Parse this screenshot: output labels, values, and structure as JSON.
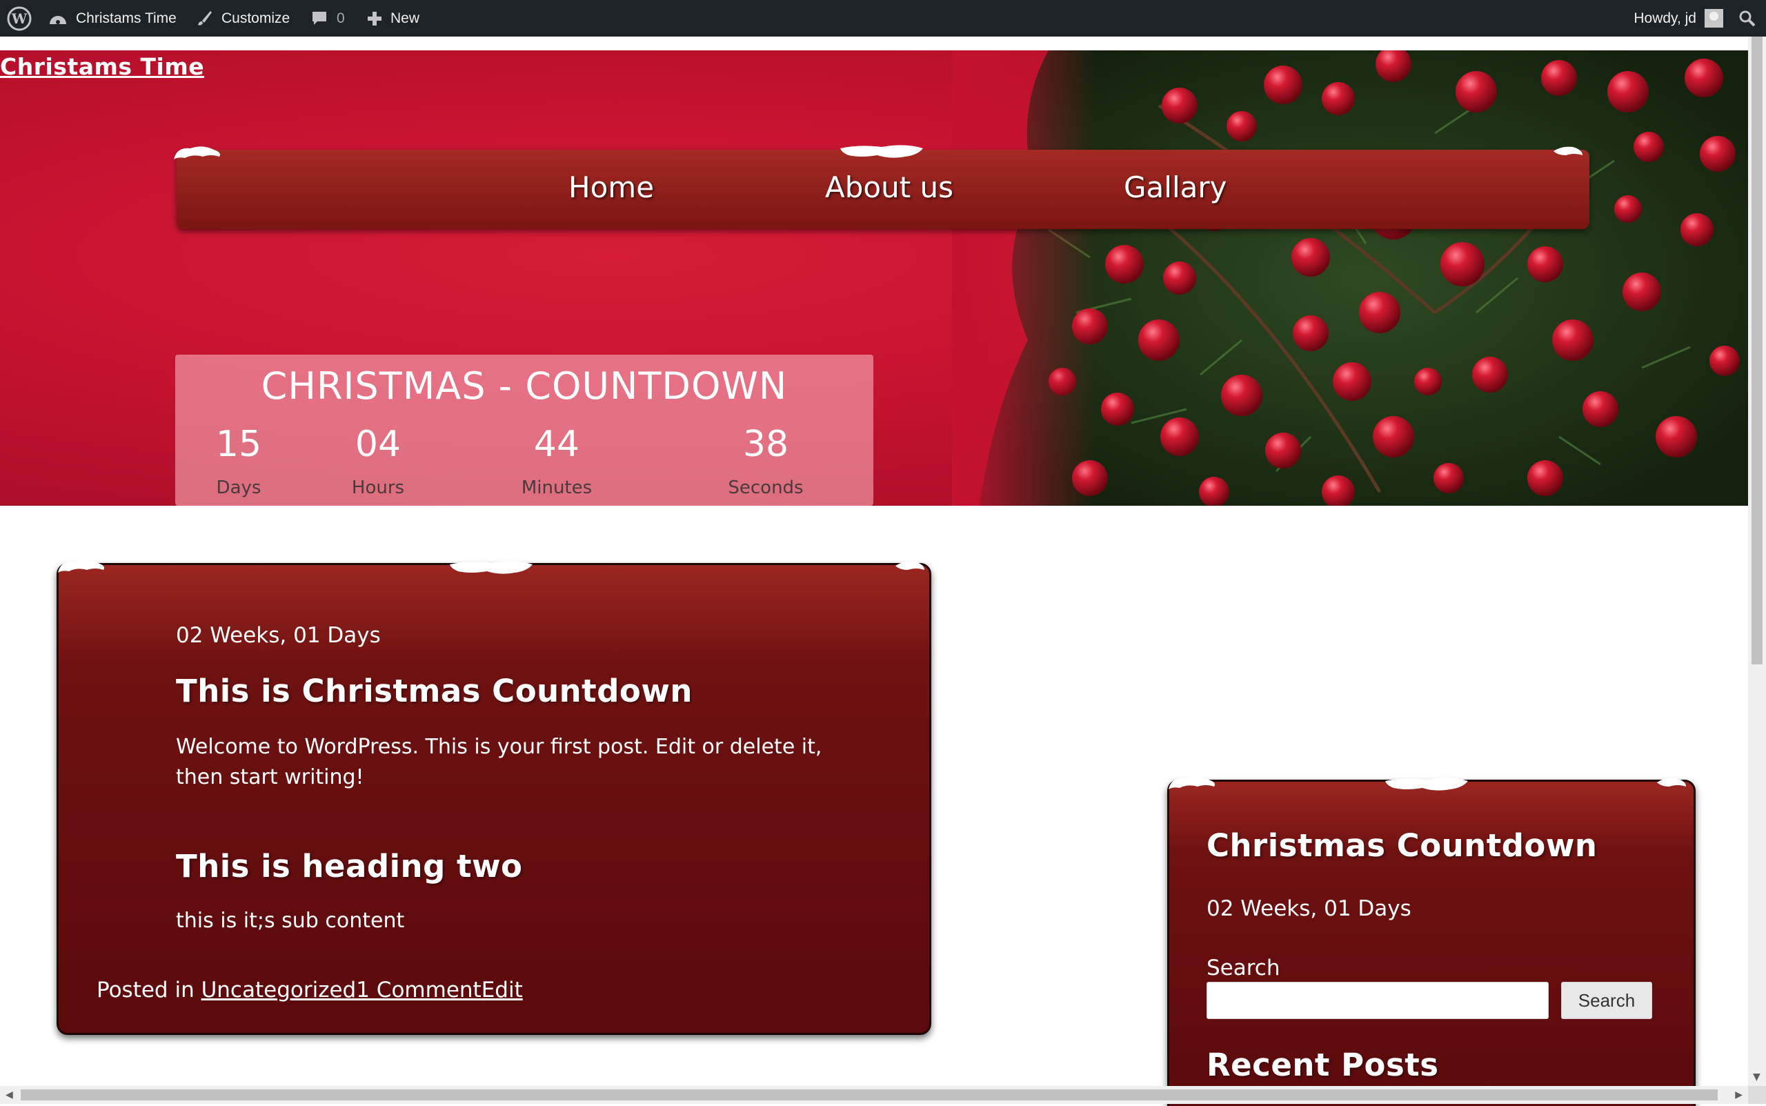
{
  "adminbar": {
    "site_name": "Christams Time",
    "customize": "Customize",
    "comments_count": "0",
    "new_label": "New",
    "howdy": "Howdy, jd"
  },
  "hero": {
    "site_title": "Christams Time",
    "nav": [
      "Home",
      "About us",
      "Gallary"
    ]
  },
  "countdown": {
    "title": "CHRISTMAS - COUNTDOWN",
    "units": [
      {
        "value": "15",
        "label": "Days"
      },
      {
        "value": "04",
        "label": "Hours"
      },
      {
        "value": "44",
        "label": "Minutes"
      },
      {
        "value": "38",
        "label": "Seconds"
      }
    ]
  },
  "post": {
    "date": "02 Weeks, 01 Days",
    "title": "This is Christmas Countdown",
    "body": "Welcome to WordPress. This is your first post. Edit or delete it, then start writing!",
    "heading_two": "This is heading two",
    "sub_content": "this is it;s sub content",
    "meta_prefix": "Posted in ",
    "category": "Uncategorized",
    "comments": "1 Comment",
    "edit": "Edit"
  },
  "sidebar": {
    "title": "Christmas Countdown",
    "date": "02 Weeks, 01 Days",
    "search_label": "Search",
    "search_button": "Search",
    "recent_posts": "Recent Posts"
  },
  "colors": {
    "adminbar": "#1d2327",
    "hero_red": "#c41230",
    "box_red": "#6e1111"
  }
}
